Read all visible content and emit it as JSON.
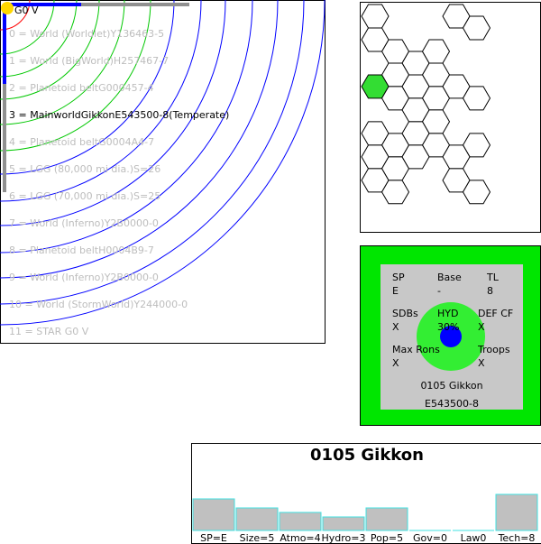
{
  "orbits": {
    "star": "G0 V",
    "items": [
      {
        "label": "0 = World  (Worldlet)Y136463-5",
        "main": false
      },
      {
        "label": "1 = World  (BigWorld)H257467-7",
        "main": false
      },
      {
        "label": "2 = Planetoid beltG000457-4",
        "main": false
      },
      {
        "label": "3 = MainworldGikkonE543500-8(Temperate)",
        "main": true
      },
      {
        "label": "4 = Planetoid beltG0004A4-7",
        "main": false
      },
      {
        "label": "5 = LGG (80,000 mi dia.)S=26",
        "main": false
      },
      {
        "label": "6 = LGG (70,000 mi dia.)S=25",
        "main": false
      },
      {
        "label": "7 = World  (Inferno)Y2B0000-0",
        "main": false
      },
      {
        "label": "8 = Planetoid beltH0004B9-7",
        "main": false
      },
      {
        "label": "9 = World  (Inferno)Y2B0000-0",
        "main": false
      },
      {
        "label": "10 = World  (StormWorld)Y244000-0",
        "main": false
      },
      {
        "label": "11 = STAR G0 V",
        "main": false
      }
    ],
    "colors": {
      "star": "#ffd700",
      "ring_blue": "#0000ff",
      "ring_green": "#00c800",
      "ring_red": "#ff0000",
      "bar_blue": "#0000ff",
      "bar_gray": "#909090"
    }
  },
  "hexmap": {
    "selected_color": "#33dd33",
    "hexes": [
      {
        "col": 0,
        "row": 0
      },
      {
        "col": 1,
        "row": 1
      },
      {
        "col": 2,
        "row": 2
      },
      {
        "col": 3,
        "row": 1
      },
      {
        "col": 3,
        "row": 2
      },
      {
        "col": 4,
        "row": 0
      },
      {
        "col": 5,
        "row": 0
      },
      {
        "col": 0,
        "row": 1
      },
      {
        "col": 1,
        "row": 2
      },
      {
        "col": 0,
        "row": 3,
        "selected": true
      },
      {
        "col": 1,
        "row": 3
      },
      {
        "col": 2,
        "row": 3
      },
      {
        "col": 3,
        "row": 3
      },
      {
        "col": 4,
        "row": 3
      },
      {
        "col": 5,
        "row": 3
      },
      {
        "col": 2,
        "row": 4
      },
      {
        "col": 3,
        "row": 4
      },
      {
        "col": 0,
        "row": 5
      },
      {
        "col": 1,
        "row": 5
      },
      {
        "col": 2,
        "row": 5
      },
      {
        "col": 3,
        "row": 5
      },
      {
        "col": 5,
        "row": 5
      },
      {
        "col": 0,
        "row": 6
      },
      {
        "col": 1,
        "row": 6
      },
      {
        "col": 2,
        "row": 6
      },
      {
        "col": 4,
        "row": 6
      },
      {
        "col": 0,
        "row": 7
      },
      {
        "col": 1,
        "row": 7
      },
      {
        "col": 4,
        "row": 7
      },
      {
        "col": 5,
        "row": 7
      }
    ]
  },
  "world": {
    "sp_label": "SP",
    "sp_value": "E",
    "base_label": "Base",
    "base_value": "-",
    "tl_label": "TL",
    "tl_value": "8",
    "sdbs_label": "SDBs",
    "sdbs_value": "X",
    "hyd_label": "HYD",
    "hyd_value": "30%",
    "def_label": "DEF CF",
    "def_value": "X",
    "maxrons_label": "Max Rons",
    "maxrons_value": "X",
    "troops_label": "Troops",
    "troops_value": "X",
    "hex_name": "0105 Gikkon",
    "uwp": "E543500-8",
    "colors": {
      "outer": "#00e600",
      "inner": "#c8c8c8",
      "ring": "#33ee33",
      "core": "#0000ff"
    }
  },
  "uwp_chart": {
    "title": "0105 Gikkon",
    "chart_data": {
      "type": "bar",
      "categories": [
        "SP=E",
        "Size=5",
        "Atmo=4",
        "Hydro=3",
        "Pop=5",
        "Gov=0",
        "Law0",
        "Tech=8"
      ],
      "values": [
        14,
        10,
        8,
        6,
        10,
        0,
        0,
        16
      ],
      "ylim": [
        0,
        16
      ],
      "bar_color": "#c0c0c0",
      "bar_stroke": "#40e0e0"
    }
  }
}
